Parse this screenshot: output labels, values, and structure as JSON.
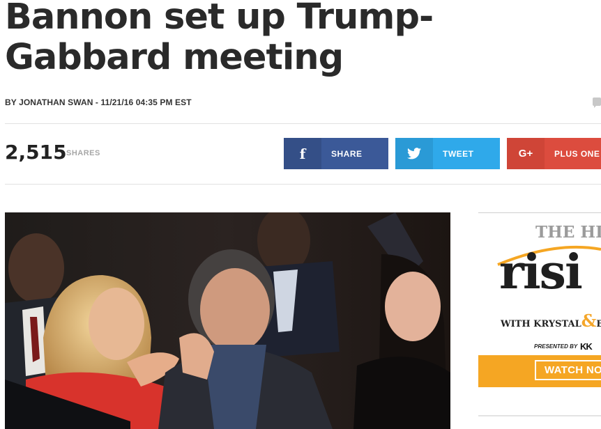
{
  "article": {
    "headline": "Bannon set up Trump-Gabbard meeting",
    "byline": "BY JONATHAN SWAN - 11/21/16 04:35 PM EST"
  },
  "shares": {
    "count": "2,515",
    "label": "SHARES"
  },
  "social": {
    "facebook": {
      "label": "SHARE",
      "icon": "facebook-icon",
      "color": "#3b5998",
      "glyph": "f"
    },
    "twitter": {
      "label": "TWEET",
      "icon": "twitter-icon",
      "color": "#2fa9ea"
    },
    "google": {
      "label": "PLUS ONE",
      "icon": "google-plus-icon",
      "color": "#dc4c3e",
      "glyph": "G+"
    }
  },
  "ad": {
    "brand": "THE HI",
    "show": "risi",
    "hosts_prefix": "WITH KRYSTAL",
    "hosts_amp": "&",
    "hosts_suffix": "B",
    "presented_by": "PRESENTED BY",
    "sponsor": "KK",
    "cta": "WATCH NO",
    "accent_color": "#f5a623"
  }
}
